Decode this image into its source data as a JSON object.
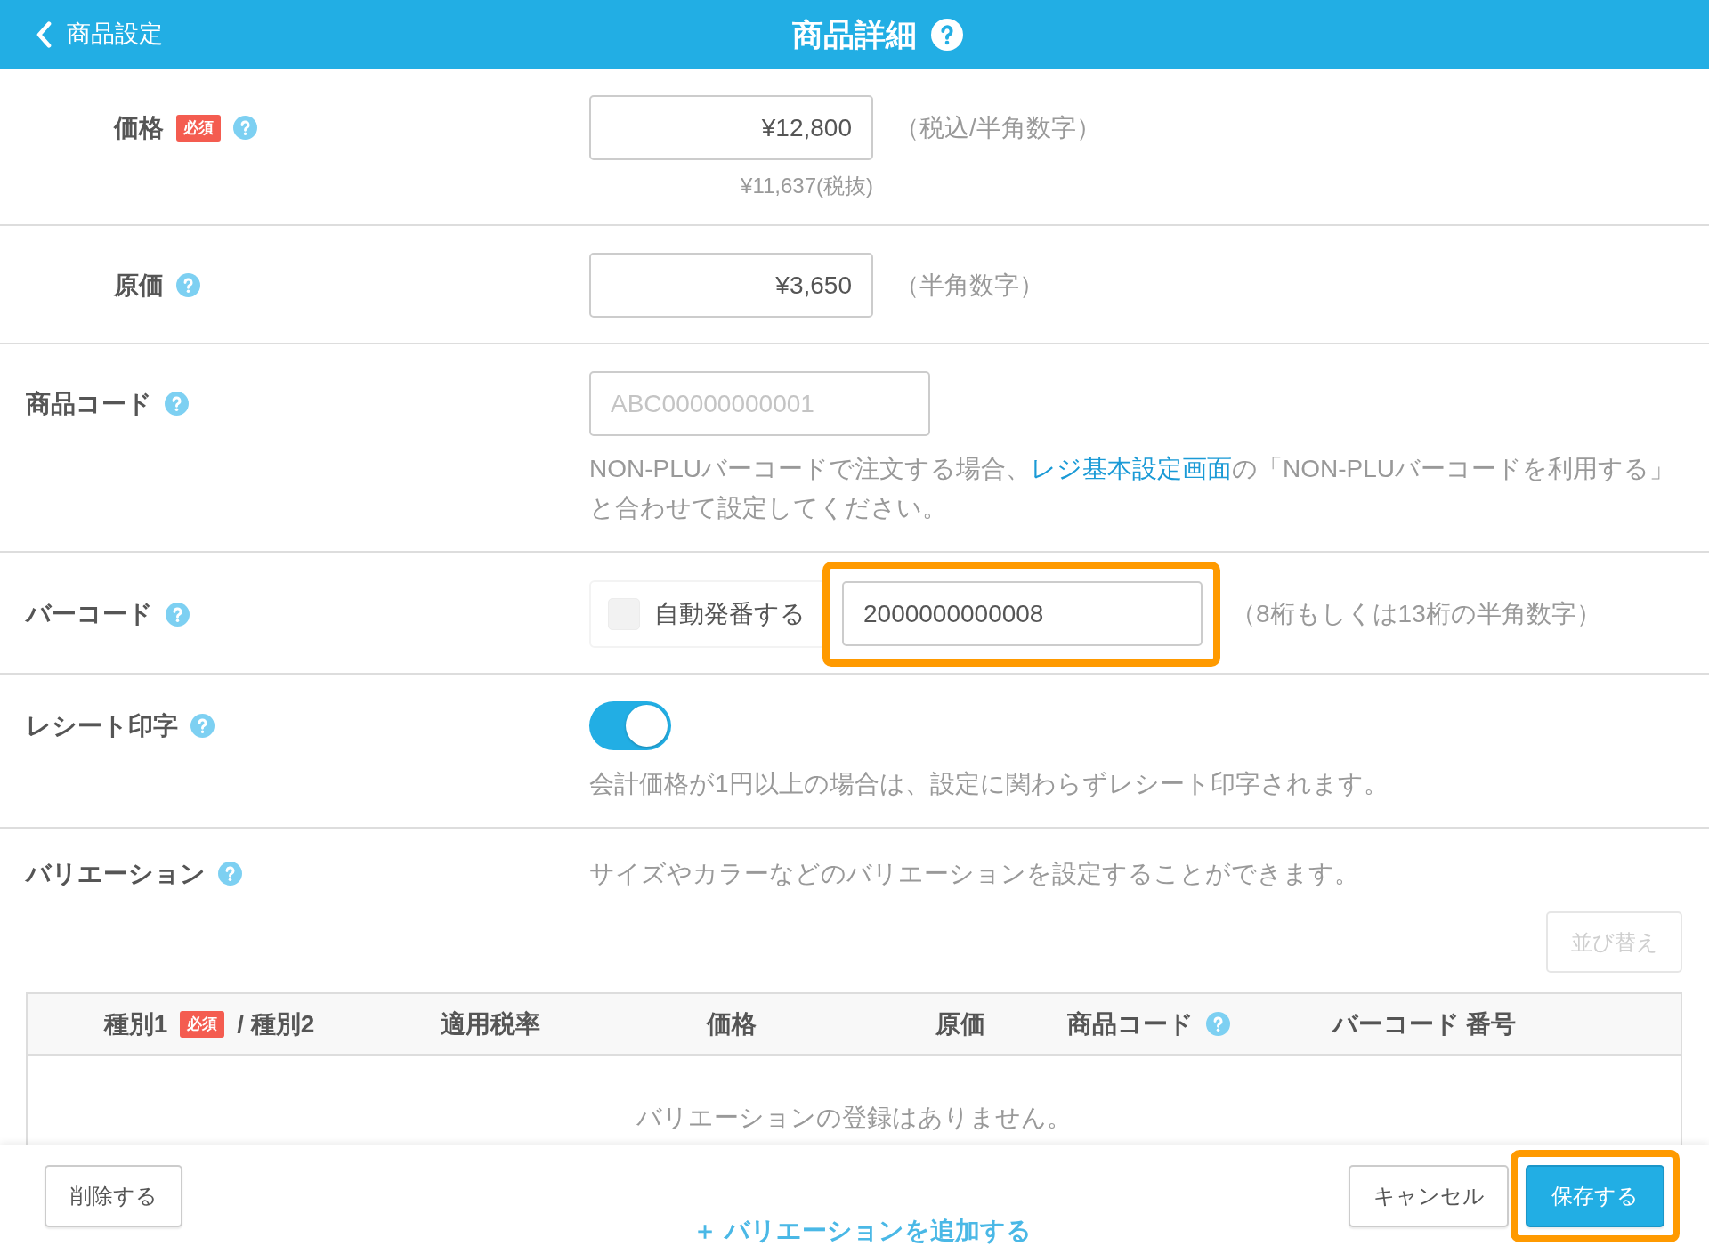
{
  "header": {
    "back_label": "商品設定",
    "title": "商品詳細",
    "help": true
  },
  "rows": [
    {
      "kind": "amount",
      "label": "価格",
      "badge": "必須",
      "help": true,
      "value": "¥12,800",
      "note": "（税込/半角数字）",
      "sub_value": "¥11,637(税抜)"
    },
    {
      "kind": "amount",
      "label": "原価",
      "help": true,
      "value": "¥3,650",
      "note": "（半角数字）"
    },
    {
      "kind": "code",
      "label": "商品コード",
      "help": true,
      "placeholder": "ABC00000000001",
      "help_text": {
        "before": "NON-PLUバーコードで注文する場合、",
        "link": "レジ基本設定画面",
        "after": "の「NON-PLUバーコードを利用する」と合わせて設定してください。"
      }
    },
    {
      "kind": "barcode",
      "label": "バーコード",
      "help": true,
      "checkbox_label": "自動発番する",
      "checked": false,
      "value": "2000000000008",
      "highlighted": true,
      "note": "（8桁もしくは13桁の半角数字）"
    },
    {
      "kind": "toggle",
      "label": "レシート印字",
      "help": true,
      "on": true,
      "note": "会計価格が1円以上の場合は、設定に関わらずレシート印字されます。"
    },
    {
      "kind": "variation",
      "label": "バリエーション",
      "help": true,
      "description": "サイズやカラーなどのバリエーションを設定することができます。",
      "sort_button": {
        "label": "並び替え",
        "disabled": true
      },
      "table": {
        "columns": [
          {
            "label": "種別1",
            "badge": "必須",
            "suffix": "/ 種別2",
            "help": false
          },
          {
            "label": "適用税率",
            "help": false
          },
          {
            "label": "価格",
            "help": false
          },
          {
            "label": "原価",
            "help": false
          },
          {
            "label": "商品コード",
            "help": true
          },
          {
            "label": "バーコード 番号",
            "help": false
          }
        ],
        "empty_text": "バリエーションの登録はありません。",
        "add_link": "＋ バリエーションを追加する"
      }
    }
  ],
  "footer": {
    "left_buttons": [
      {
        "kind": "delete",
        "label": "削除する",
        "highlighted": false
      }
    ],
    "right_buttons": [
      {
        "kind": "cancel",
        "label": "キャンセル",
        "highlighted": false
      },
      {
        "kind": "save",
        "label": "保存する",
        "highlighted": true
      }
    ]
  }
}
